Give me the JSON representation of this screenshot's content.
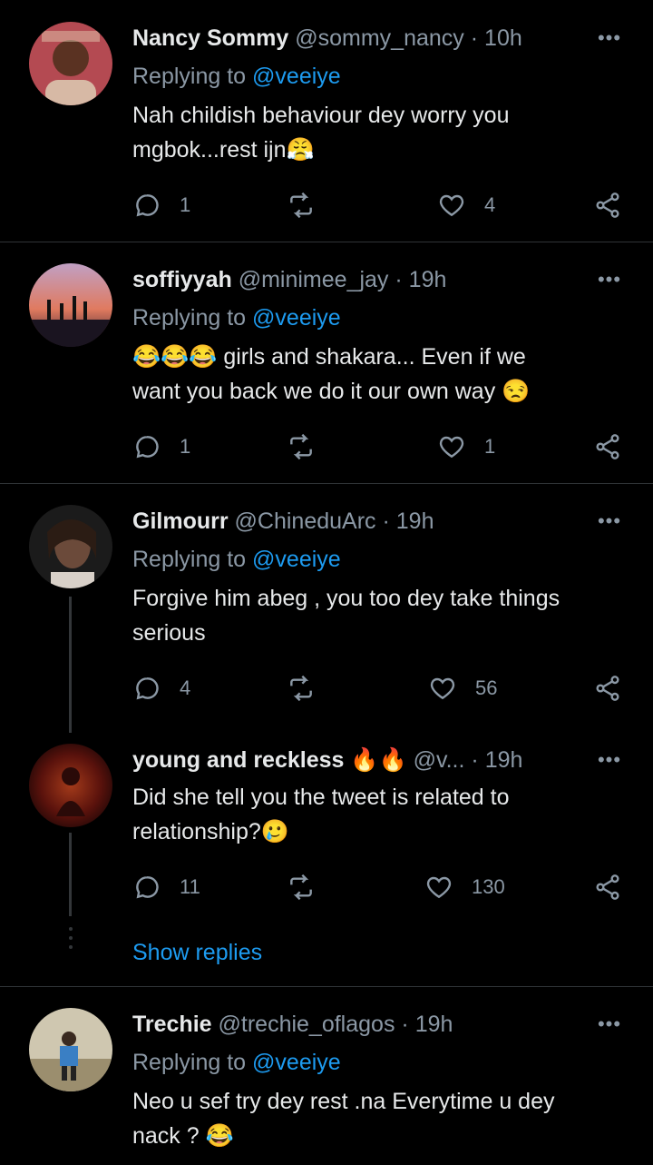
{
  "tweets": [
    {
      "name": "Nancy Sommy",
      "handle": "@sommy_nancy",
      "time": "10h",
      "replying_prefix": "Replying to ",
      "replying_to": "@veeiye",
      "text_lines": [
        "Nah childish behaviour dey worry you",
        "mgbok...rest ijn😤"
      ],
      "replies": "1",
      "retweets": "",
      "likes": "4"
    },
    {
      "name": "soffiyyah",
      "handle": "@minimee_jay",
      "time": "19h",
      "replying_prefix": "Replying to ",
      "replying_to": "@veeiye",
      "text_lines": [
        "😂😂😂 girls and shakara... Even if we",
        "want you back we do it our own way 😒"
      ],
      "replies": "1",
      "retweets": "",
      "likes": "1"
    },
    {
      "name": "Gilmourr",
      "handle": "@ChineduArc",
      "time": "19h",
      "replying_prefix": "Replying to ",
      "replying_to": "@veeiye",
      "text_lines": [
        "Forgive him abeg , you too dey take things",
        "serious"
      ],
      "replies": "4",
      "retweets": "",
      "likes": "56"
    },
    {
      "name": "young and reckless 🔥🔥",
      "handle": "@v...",
      "time": "19h",
      "text_lines": [
        "Did she tell you the tweet  is related to",
        "relationship?🥲"
      ],
      "replies": "11",
      "retweets": "",
      "likes": "130"
    },
    {
      "name": "Trechie",
      "handle": "@trechie_oflagos",
      "time": "19h",
      "replying_prefix": "Replying to ",
      "replying_to": "@veeiye",
      "text_lines": [
        "Neo u sef try dey rest .na Everytime u dey",
        "nack ? 😂"
      ]
    }
  ],
  "show_replies": "Show replies",
  "icons": {
    "more": "more-options-icon",
    "reply": "reply-icon",
    "retweet": "retweet-icon",
    "like": "heart-icon",
    "share": "share-icon"
  },
  "colors": {
    "background": "#000000",
    "text": "#e7e9ea",
    "muted": "#8b98a5",
    "accent": "#1d9bf0",
    "divider": "#2f3336"
  }
}
